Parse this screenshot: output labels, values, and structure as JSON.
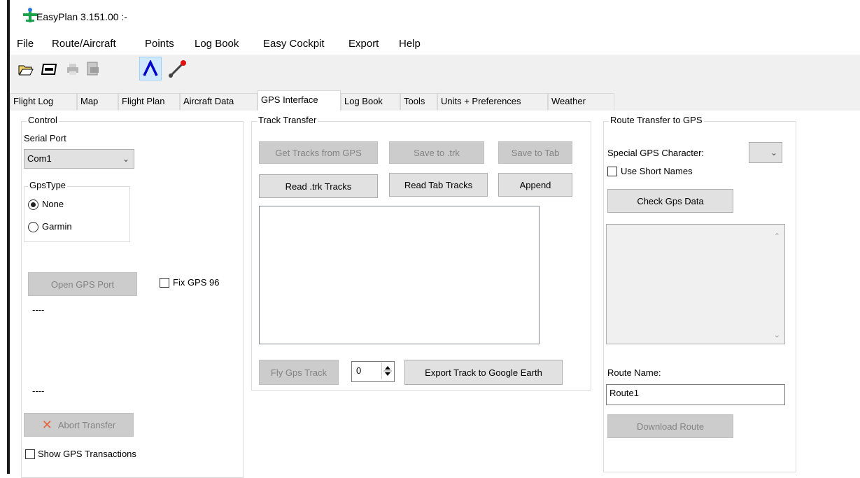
{
  "window": {
    "title": "EasyPlan 3.151.00 :-"
  },
  "menu": [
    "File",
    "Route/Aircraft",
    "Points",
    "Log Book",
    "Easy Cockpit",
    "Export",
    "Help"
  ],
  "toolbar": {
    "icons": [
      "open-folder-icon",
      "save-disk-icon",
      "print-icon",
      "print-preview-icon",
      "route-profile-icon",
      "line-draw-icon"
    ]
  },
  "tabs": [
    "Flight Log",
    "Map",
    "Flight Plan",
    "Aircraft Data",
    "GPS Interface",
    "Log Book",
    "Tools",
    "Units + Preferences",
    "Weather"
  ],
  "active_tab": "GPS Interface",
  "control": {
    "legend": "Control",
    "serial_port_label": "Serial Port",
    "serial_port_value": "Com1",
    "gpstype_legend": "GpsType",
    "radio_none": "None",
    "radio_garmin": "Garmin",
    "open_port_label": "Open GPS Port",
    "fix_gps_label": "Fix GPS 96",
    "status1": "----",
    "status2": "----",
    "abort_label": "Abort Transfer",
    "show_transactions_label": "Show GPS Transactions"
  },
  "track": {
    "legend": "Track Transfer",
    "get_tracks": "Get Tracks from GPS",
    "save_trk": "Save to .trk",
    "save_tab": "Save to Tab",
    "read_trk": "Read .trk Tracks",
    "read_tab": "Read Tab Tracks",
    "append": "Append",
    "fly_track": "Fly Gps Track",
    "spin_value": "0",
    "export_ge": "Export Track to Google Earth"
  },
  "route": {
    "legend": "Route Transfer to GPS",
    "special_char_label": "Special GPS Character:",
    "short_names_label": "Use Short Names",
    "check_data": "Check Gps Data",
    "route_name_label": "Route Name:",
    "route_name_value": "Route1",
    "download": "Download Route"
  },
  "colors": {
    "accent": "#0000cc",
    "disabled_text": "#838383",
    "disabled_bg": "#cccccc",
    "abort_x": "#e8603c"
  }
}
